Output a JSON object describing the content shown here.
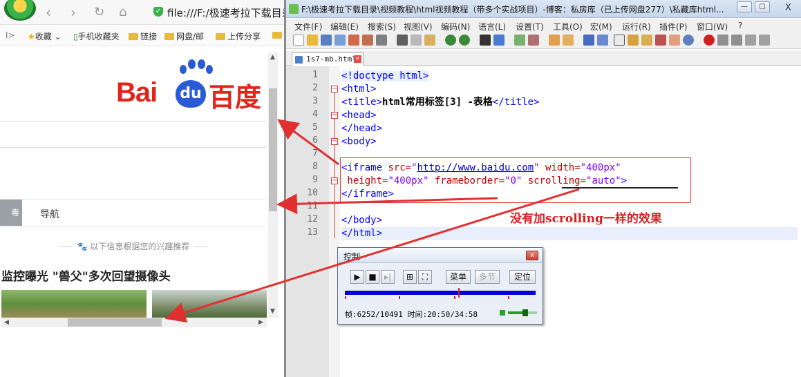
{
  "browser": {
    "url": "file:///F:/极速考拉下载目录",
    "bookmarks": [
      {
        "label": "收藏",
        "icon": "star-icon"
      },
      {
        "label": "手机收藏夹",
        "icon": "phone-icon"
      },
      {
        "label": "链接",
        "icon": "folder-icon"
      },
      {
        "label": "网盘/邮",
        "icon": "folder-icon"
      },
      {
        "label": "上传分享",
        "icon": "folder-icon"
      }
    ],
    "baidu": {
      "bai": "Bai",
      "du": "du",
      "cn": "百度"
    },
    "nav_tab_left": "毒",
    "nav_label": "导航",
    "interest_text": "以下信息根据您的兴趣推荐",
    "headline": "监控曝光 \"兽父\"多次回望摄像头"
  },
  "editor": {
    "title": "F:\\极速考拉下载目录\\视频教程\\html视频教程（带多个实战项目）-博客：私房库（已上传网盘277）\\私藏库html...",
    "close_label": "X",
    "menus": [
      "文件(F)",
      "编辑(E)",
      "搜索(S)",
      "视图(V)",
      "编码(N)",
      "语言(L)",
      "设置(T)",
      "工具(O)",
      "宏(M)",
      "运行(R)",
      "插件(P)",
      "窗口(W)",
      "?"
    ],
    "tab_label": "1s7-mb.html",
    "line_numbers": [
      "1",
      "2",
      "3",
      "4",
      "5",
      "6",
      "7",
      "8",
      "9",
      "10",
      "11",
      "12",
      "13"
    ],
    "code": {
      "l1": "<!doctype html>",
      "l2": "<html>",
      "l3_open": "<title>",
      "l3_text": "html常用标签[3] -表格",
      "l3_close": "</title>",
      "l4": "<head>",
      "l5": "</head>",
      "l6": "<body>",
      "l8_tag": "<iframe ",
      "l8_src_attr": "src=",
      "l8_src_val": "http://www.baidu.com",
      "l8_w_attr": " width=",
      "l8_w_val": "\"400px\"",
      "l9_h_attr": " height=",
      "l9_h_val": "\"400px\"",
      "l9_fb_attr": " frameborder=",
      "l9_fb_val": "\"0\"",
      "l9_sc_attr": " scrolling=",
      "l9_sc_val": "\"auto\"",
      "l9_end": ">",
      "l10": "</iframe>",
      "l12": "</body>",
      "l13": "</html>"
    },
    "annotation": "没有加scrolling一样的效果"
  },
  "control": {
    "title": "控制",
    "close": "x",
    "menu_button": "菜单",
    "chapter_button": "多节",
    "locate_button": "定位",
    "frame_label": "帧:",
    "frame_value": "6252/10491",
    "time_label": "时间:",
    "time_value": "20:50/34:58",
    "progress": 0.596,
    "volume": 0.6
  },
  "colors": {
    "annotation_red": "#e04040",
    "tag_blue": "#0000ff",
    "attr_red": "#c00000",
    "value_purple": "#8000ff"
  }
}
